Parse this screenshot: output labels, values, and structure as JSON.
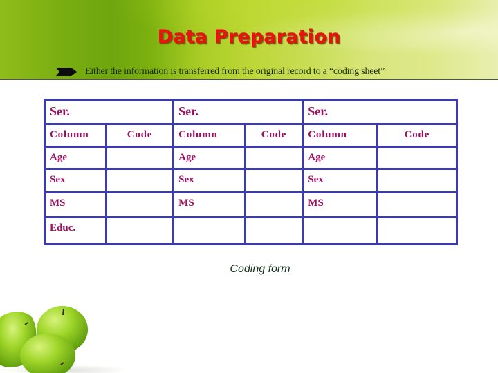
{
  "slide": {
    "title": "Data Preparation",
    "bullet_icon": "arrow-bullet-icon",
    "bullet_text": "Either the information is transferred from the original record to a “coding sheet”",
    "caption": "Coding form",
    "image": "green-apples-image"
  },
  "coding_table": {
    "groups": [
      {
        "header": "Ser.",
        "column_label": "Column",
        "code_label": "Code",
        "rows": [
          "Age",
          "Sex",
          "MS",
          "Educ."
        ]
      },
      {
        "header": "Ser.",
        "column_label": "Column",
        "code_label": "Code",
        "rows": [
          "Age",
          "Sex",
          "MS",
          ""
        ]
      },
      {
        "header": "Ser.",
        "column_label": "Column",
        "code_label": "Code",
        "rows": [
          "Age",
          "Sex",
          "MS",
          ""
        ]
      }
    ]
  },
  "colors": {
    "title": "#e8120f",
    "table_border": "#3b3bad",
    "table_text": "#9a0f5e",
    "banner_green": "#7aae12"
  }
}
